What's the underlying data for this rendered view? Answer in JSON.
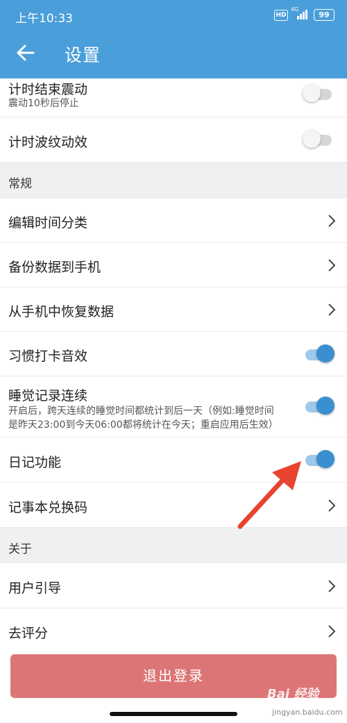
{
  "status_bar": {
    "time": "上午10:33",
    "hd": "HD",
    "network": "4G",
    "battery": "99"
  },
  "app_bar": {
    "title": "设置",
    "back_icon": "arrow-left-icon"
  },
  "timer": {
    "vibrate": {
      "label": "计时结束震动",
      "desc": "震动10秒后停止",
      "on": false
    },
    "ripple": {
      "label": "计时波纹动效",
      "on": false
    }
  },
  "general": {
    "header": "常规",
    "edit_categories": "编辑时间分类",
    "backup": "备份数据到手机",
    "restore": "从手机中恢复数据",
    "habit_sound": {
      "label": "习惯打卡音效",
      "on": true
    },
    "sleep_continuous": {
      "label": "睡觉记录连续",
      "desc_line1": "开启后，跨天连续的睡觉时间都统计到后一天（例如:睡觉时间",
      "desc_line2": "是昨天23:00到今天06:00都将统计在今天；重启应用后生效）",
      "on": true
    },
    "diary": {
      "label": "日记功能",
      "on": true
    },
    "notebook_code": "记事本兑换码"
  },
  "about": {
    "header": "关于",
    "user_guide": "用户引导",
    "rate": "去评分"
  },
  "logout_label": "退出登录",
  "watermark": {
    "brand": "Bai 经验",
    "url": "jingyan.baidu.com"
  },
  "colors": {
    "primary": "#4a9ed9",
    "toggle_on": "#3a8fd0",
    "logout": "#dc7676",
    "annotation_arrow": "#e8432f"
  }
}
